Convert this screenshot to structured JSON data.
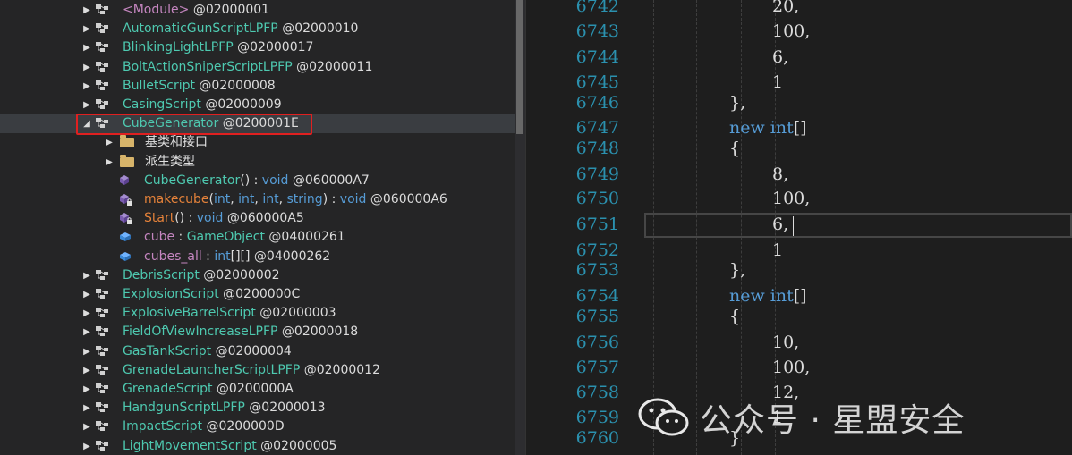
{
  "tree": {
    "items": [
      {
        "arrow": "▶",
        "indent": "class",
        "kind": "class",
        "name": "<Module>",
        "addr": "@02000001",
        "name_color": "#c586c0"
      },
      {
        "arrow": "▶",
        "indent": "class",
        "kind": "class",
        "name": "AutomaticGunScriptLPFP",
        "addr": "@02000010"
      },
      {
        "arrow": "▶",
        "indent": "class",
        "kind": "class",
        "name": "BlinkingLightLPFP",
        "addr": "@02000017"
      },
      {
        "arrow": "▶",
        "indent": "class",
        "kind": "class",
        "name": "BoltActionSniperScriptLPFP",
        "addr": "@02000011"
      },
      {
        "arrow": "▶",
        "indent": "class",
        "kind": "class",
        "name": "BulletScript",
        "addr": "@02000008"
      },
      {
        "arrow": "▶",
        "indent": "class",
        "kind": "class",
        "name": "CasingScript",
        "addr": "@02000009"
      },
      {
        "arrow": "◢",
        "indent": "class",
        "kind": "class",
        "name": "CubeGenerator",
        "addr": "@0200001E",
        "selected": true
      },
      {
        "arrow": "▶",
        "indent": "child",
        "kind": "folder",
        "name": "基类和接口",
        "addr": ""
      },
      {
        "arrow": "▶",
        "indent": "child",
        "kind": "folder",
        "name": "派生类型",
        "addr": ""
      },
      {
        "arrow": "",
        "indent": "child",
        "kind": "method",
        "name": "CubeGenerator",
        "sig": "() : void",
        "addr": "@060000A7"
      },
      {
        "arrow": "",
        "indent": "child",
        "kind": "method-private",
        "name": "makecube",
        "sig": "(int, int, int, string) : void",
        "addr": "@060000A6"
      },
      {
        "arrow": "",
        "indent": "child",
        "kind": "method-private",
        "name": "Start",
        "sig": "() : void",
        "addr": "@060000A5"
      },
      {
        "arrow": "",
        "indent": "child",
        "kind": "field",
        "name": "cube",
        "sig": " : GameObject",
        "addr": "@04000261"
      },
      {
        "arrow": "",
        "indent": "child",
        "kind": "field",
        "name": "cubes_all",
        "sig": " : int[][]",
        "addr": "@04000262"
      },
      {
        "arrow": "▶",
        "indent": "class",
        "kind": "class",
        "name": "DebrisScript",
        "addr": "@02000002"
      },
      {
        "arrow": "▶",
        "indent": "class",
        "kind": "class",
        "name": "ExplosionScript",
        "addr": "@0200000C"
      },
      {
        "arrow": "▶",
        "indent": "class",
        "kind": "class",
        "name": "ExplosiveBarrelScript",
        "addr": "@02000003"
      },
      {
        "arrow": "▶",
        "indent": "class",
        "kind": "class",
        "name": "FieldOfViewIncreaseLPFP",
        "addr": "@02000018"
      },
      {
        "arrow": "▶",
        "indent": "class",
        "kind": "class",
        "name": "GasTankScript",
        "addr": "@02000004"
      },
      {
        "arrow": "▶",
        "indent": "class",
        "kind": "class",
        "name": "GrenadeLauncherScriptLPFP",
        "addr": "@02000012"
      },
      {
        "arrow": "▶",
        "indent": "class",
        "kind": "class",
        "name": "GrenadeScript",
        "addr": "@0200000A"
      },
      {
        "arrow": "▶",
        "indent": "class",
        "kind": "class",
        "name": "HandgunScriptLPFP",
        "addr": "@02000013"
      },
      {
        "arrow": "▶",
        "indent": "class",
        "kind": "class",
        "name": "ImpactScript",
        "addr": "@0200000D"
      },
      {
        "arrow": "▶",
        "indent": "class",
        "kind": "class",
        "name": "LightMovementScript",
        "addr": "@02000005"
      }
    ]
  },
  "editor": {
    "lines": [
      {
        "num": "6742",
        "code": "20,",
        "level": 3
      },
      {
        "num": "6743",
        "code": "100,",
        "level": 3
      },
      {
        "num": "6744",
        "code": "6,",
        "level": 3
      },
      {
        "num": "6745",
        "code": "1",
        "level": 3
      },
      {
        "num": "6746",
        "code": "},",
        "level": 2
      },
      {
        "num": "6747",
        "code": "new int[]",
        "level": 2,
        "kw": "new int"
      },
      {
        "num": "6748",
        "code": "{",
        "level": 2
      },
      {
        "num": "6749",
        "code": "8,",
        "level": 3
      },
      {
        "num": "6750",
        "code": "100,",
        "level": 3
      },
      {
        "num": "6751",
        "code": "6,",
        "level": 3,
        "current": true
      },
      {
        "num": "6752",
        "code": "1",
        "level": 3
      },
      {
        "num": "6753",
        "code": "},",
        "level": 2
      },
      {
        "num": "6754",
        "code": "new int[]",
        "level": 2,
        "kw": "new int"
      },
      {
        "num": "6755",
        "code": "{",
        "level": 2
      },
      {
        "num": "6756",
        "code": "10,",
        "level": 3
      },
      {
        "num": "6757",
        "code": "100,",
        "level": 3
      },
      {
        "num": "6758",
        "code": "12,",
        "level": 3
      },
      {
        "num": "6759",
        "code": "1",
        "level": 3
      },
      {
        "num": "6760",
        "code": "}",
        "level": 2
      }
    ]
  },
  "watermark": {
    "text": "公众号 · 星盟安全",
    "icon": "wechat-logo-icon"
  },
  "colors": {
    "selection_box": "#e02020",
    "line_number": "#2b91af",
    "keyword": "#569cd6",
    "type_name": "#4ec9b0"
  }
}
